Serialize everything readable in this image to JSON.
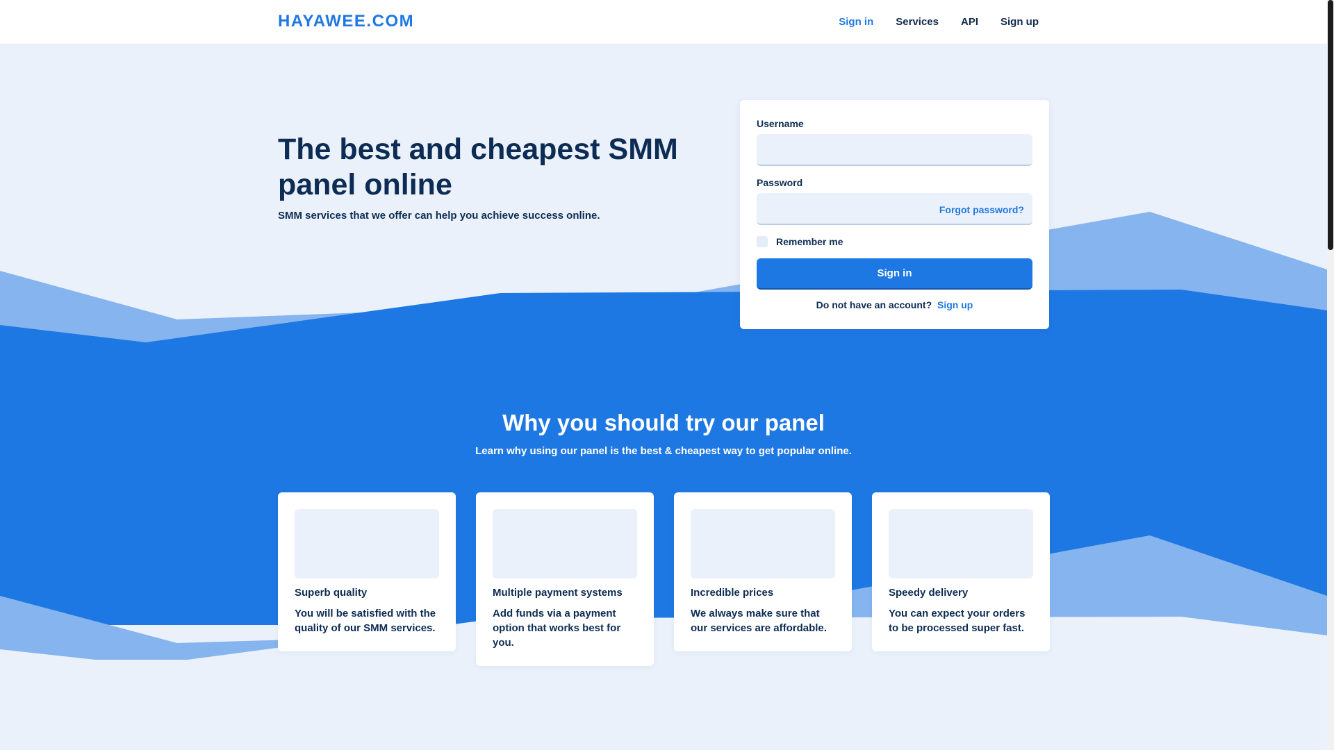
{
  "nav": {
    "brand": "HAYAWEE.COM",
    "links": [
      "Sign in",
      "Services",
      "API",
      "Sign up"
    ]
  },
  "hero": {
    "title": "The best and cheapest SMM panel online",
    "subtitle": "SMM services that we offer can help you achieve success online."
  },
  "login": {
    "username_label": "Username",
    "password_label": "Password",
    "forgot": "Forgot password?",
    "remember": "Remember me",
    "signin_button": "Sign in",
    "no_account": "Do not have an account?",
    "signup_link": "Sign up"
  },
  "why": {
    "title": "Why you should try our panel",
    "subtitle": "Learn why using our panel is the best & cheapest way to get popular online."
  },
  "features": [
    {
      "title": "Superb quality",
      "desc": "You will be satisfied with the quality of our SMM services."
    },
    {
      "title": "Multiple payment systems",
      "desc": "Add funds via a payment option that works best for you."
    },
    {
      "title": "Incredible prices",
      "desc": "We always make sure that our services are affordable."
    },
    {
      "title": "Speedy delivery",
      "desc": "You can expect your orders to be processed super fast."
    }
  ],
  "colors": {
    "accent": "#1e78e3",
    "page_bg": "#eaf1fb",
    "heading": "#0d2c53"
  }
}
